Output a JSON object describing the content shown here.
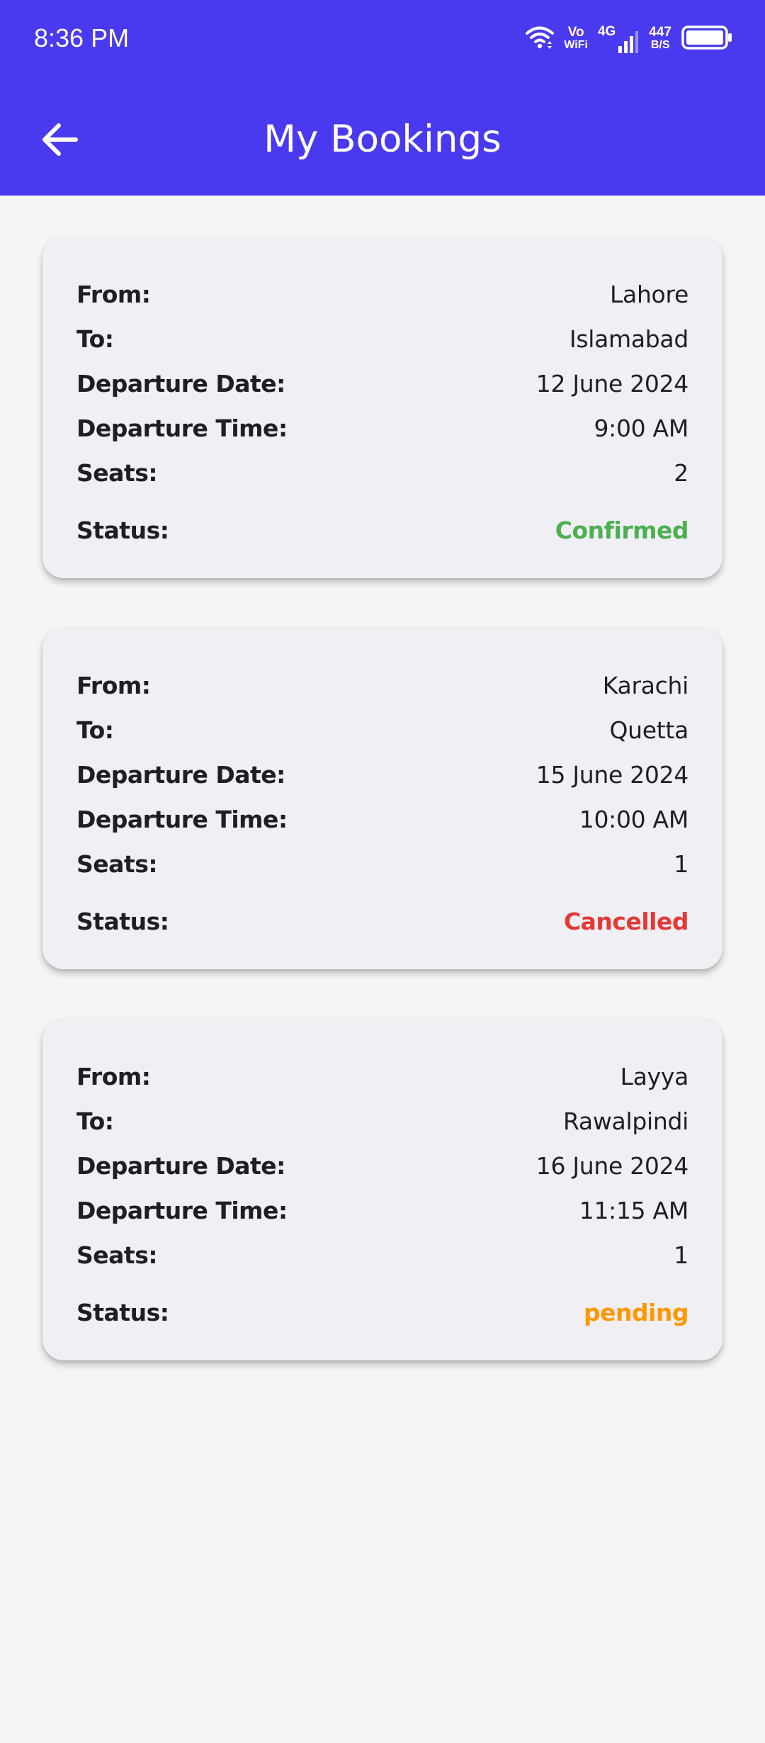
{
  "status_bar": {
    "time": "8:36 PM",
    "vowifi_top": "Vo",
    "vowifi_bottom": "WiFi",
    "network": "4G",
    "speed_value": "447",
    "speed_unit": "B/S"
  },
  "header": {
    "title": "My Bookings",
    "background_color": "#4a3aef"
  },
  "labels": {
    "from": "From:",
    "to": "To:",
    "departure_date": "Departure Date:",
    "departure_time": "Departure Time:",
    "seats": "Seats:",
    "status": "Status:"
  },
  "bookings": [
    {
      "from": "Lahore",
      "to": "Islamabad",
      "departure_date": "12 June 2024",
      "departure_time": "9:00 AM",
      "seats": "2",
      "status": "Confirmed",
      "status_color": "#4caf50"
    },
    {
      "from": "Karachi",
      "to": "Quetta",
      "departure_date": "15 June 2024",
      "departure_time": "10:00 AM",
      "seats": "1",
      "status": "Cancelled",
      "status_color": "#e53935"
    },
    {
      "from": "Layya",
      "to": "Rawalpindi",
      "departure_date": "16 June 2024",
      "departure_time": "11:15 AM",
      "seats": "1",
      "status": "pending",
      "status_color": "#ff9800"
    }
  ]
}
